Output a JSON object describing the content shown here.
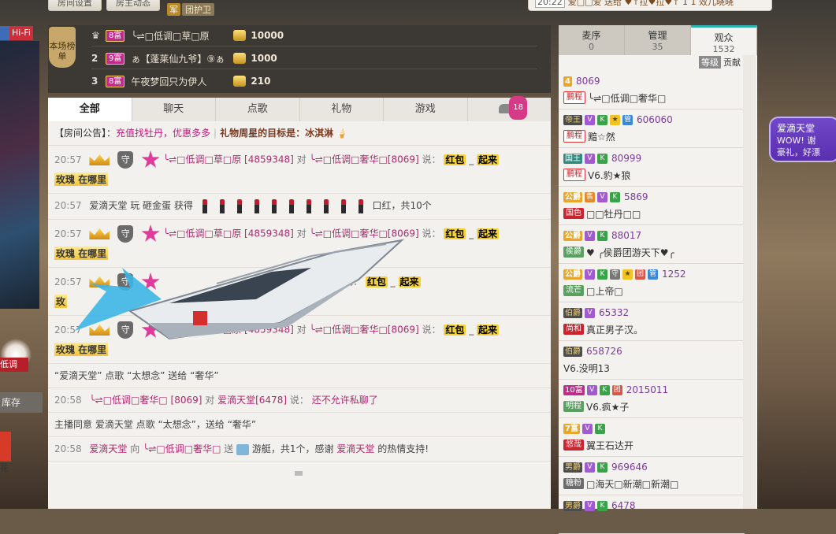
{
  "top": {
    "btn1": "房间设置",
    "btn2": "房主动态",
    "guard_icon": "军",
    "guard_label": "团护卫",
    "ticker_time": "20:22",
    "ticker_text": "爱□□爱 送给 ♥↑拉♥拉♥↑ 1 1 效儿晓晓"
  },
  "left": {
    "hifi": "Hi-Fi",
    "low_tag": "低调",
    "kucun": "库存",
    "hua": "花"
  },
  "rank": {
    "badge": "本场榜单",
    "rows": [
      {
        "num": "",
        "level": "8富",
        "name": "╰⇌□低调□草□原",
        "amount": "10000"
      },
      {
        "num": "2",
        "level": "9富",
        "name": "ぁ【蓬莱仙九爷】⑨ぁ",
        "amount": "1000"
      },
      {
        "num": "3",
        "level": "8富",
        "name": "午夜梦回只为伊人",
        "amount": "210"
      }
    ]
  },
  "tabs": [
    "全部",
    "聊天",
    "点歌",
    "礼物",
    "游戏"
  ],
  "car_count": "18",
  "notice": {
    "prefix": "【房间公告】：",
    "text1": "充值找牡丹，优惠多多",
    "sep": "|",
    "text2": "礼物周星的目标是：冰淇淋"
  },
  "messages": {
    "m1": {
      "time": "20:57",
      "shield": "守",
      "user": "╰⇌□低调□草□原 [4859348]",
      "to": "对",
      "target": "╰⇌□低调□奢华□[8069]",
      "say": "说：",
      "gold1": "红包",
      "mid": "_",
      "gold2": "起来",
      "line2": "玫瑰 在哪里"
    },
    "m2": {
      "time": "20:57",
      "text": "爱滴天堂 玩 砸金蛋 获得",
      "tail": "口红，共10个"
    },
    "m3": {
      "time": "20:57",
      "shield": "守",
      "user": "╰⇌□低调□草□原 [4859348]",
      "to": "对",
      "target": "╰⇌□低调□奢华□[8069]",
      "say": "说：",
      "gold1": "红包",
      "mid": "_",
      "gold2": "起来",
      "line2": "玫瑰 在哪里"
    },
    "m4": {
      "time": "20:57",
      "shield": "守",
      "user": "",
      "to": "",
      "target": "奢华□[8069]",
      "say": "说：",
      "gold1": "红包",
      "mid": "_",
      "gold2": "起来",
      "line2": "玫"
    },
    "m5": {
      "time": "20:57",
      "shield": "守",
      "user": "╰⇌□低调□草□原 [4859348]",
      "to": "对",
      "target": "╰⇌□低调□奢华□[8069]",
      "say": "说：",
      "gold1": "红包",
      "mid": "_",
      "gold2": "起来",
      "line2": "玫瑰 在哪里"
    },
    "m6": {
      "text": "“爱滴天堂” 点歌 “太想念” 送给 “奢华”"
    },
    "m7": {
      "time": "20:58",
      "user": "╰⇌□低调□奢华□ [8069]",
      "to": "对",
      "target": "爱滴天堂[6478]",
      "say": "说：",
      "text": "还不允许私聊了"
    },
    "m8": {
      "text": "主播同意 爱滴天堂 点歌 “太想念”，送给 “奢华”"
    },
    "m9": {
      "time": "20:58",
      "user": "爱滴天堂",
      "to": "向",
      "target": "╰⇌□低调□奢华□",
      "send": "送",
      "gift": "游艇，共1个，感谢",
      "user2": "爱滴天堂",
      "thanks": "的热情支持!"
    }
  },
  "right": {
    "tabs": [
      {
        "label": "麦序",
        "count": "0"
      },
      {
        "label": "管理",
        "count": "35"
      },
      {
        "label": "观众",
        "count": "1532"
      }
    ],
    "sub_level": "等级",
    "sub_contrib": "贡献",
    "users": [
      {
        "lvl": "4",
        "lvl_style": "gold",
        "icons": [],
        "id": "8069",
        "tag": "鹏程",
        "tag_style": "redb",
        "name": "╰⇌□低调□奢华□"
      },
      {
        "lvl": "帝王",
        "lvl_style": "dark",
        "icons": [
          "V",
          "K",
          "★",
          "管"
        ],
        "id": "606060",
        "tag": "鹏程",
        "tag_style": "redb",
        "name": "黯☆然"
      },
      {
        "lvl": "国王",
        "lvl_style": "teal",
        "icons": [
          "V",
          "K"
        ],
        "id": "80999",
        "tag": "鹏程",
        "tag_style": "redb",
        "name": "V6.豹★狼"
      },
      {
        "lvl": "公爵",
        "lvl_style": "gold",
        "icons": [
          "售",
          "V",
          "K"
        ],
        "id": "5869",
        "tag": "国色",
        "tag_style": "red",
        "name": "□□牡丹□□"
      },
      {
        "lvl": "公爵",
        "lvl_style": "gold",
        "icons": [
          "V",
          "K"
        ],
        "id": "88017",
        "tag": "侯爵",
        "tag_style": "grn",
        "name": "♥ ╭侯爵团游天下♥╭"
      },
      {
        "lvl": "公爵",
        "lvl_style": "gold",
        "icons": [
          "V",
          "K",
          "守",
          "★",
          "团",
          "管"
        ],
        "id": "1252",
        "tag": "流芒",
        "tag_style": "grn",
        "name": "□上帝□"
      },
      {
        "lvl": "伯爵",
        "lvl_style": "dark",
        "icons": [
          "V"
        ],
        "id": "65332",
        "tag": "尚和",
        "tag_style": "red",
        "name": "真正男子汉。"
      },
      {
        "lvl": "伯爵",
        "lvl_style": "dark",
        "icons": [],
        "id": "658726",
        "tag": "",
        "tag_style": "",
        "name": "V6.没明13"
      },
      {
        "lvl": "10富",
        "lvl_style": "pink",
        "icons": [
          "V",
          "K",
          "团"
        ],
        "id": "2015011",
        "tag": "明程",
        "tag_style": "grn",
        "name": "V6.疯★子"
      },
      {
        "lvl": "7富",
        "lvl_style": "gold",
        "icons": [
          "V",
          "K"
        ],
        "id": "",
        "tag": "悠哉",
        "tag_style": "red",
        "name": "翼王石达开"
      },
      {
        "lvl": "男爵",
        "lvl_style": "dark",
        "icons": [
          "V",
          "K"
        ],
        "id": "969646",
        "tag": "糖粉",
        "tag_style": "gry",
        "name": "□海天□新潮□新潮□"
      },
      {
        "lvl": "男爵",
        "lvl_style": "dark",
        "icons": [
          "V",
          "K"
        ],
        "id": "6478",
        "tag": "",
        "tag_style": "",
        "name": ""
      }
    ]
  },
  "bubble": {
    "title": "爱滴天堂",
    "line1": "WOW! 谢",
    "line2": "豪礼，好漂"
  },
  "colors": {
    "accent_teal": "#2bb3b0",
    "level_pink": "#c32b8a",
    "user_pink": "#b0286e"
  }
}
